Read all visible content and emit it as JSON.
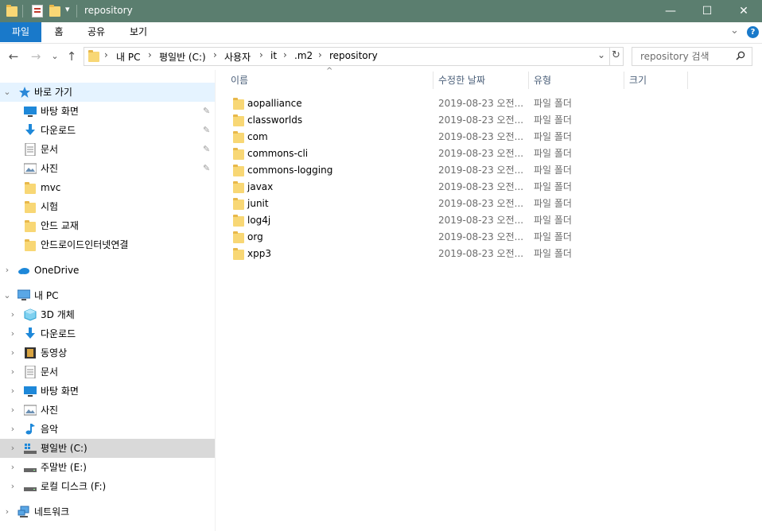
{
  "window": {
    "title": "repository",
    "qat_dropdown": "▾",
    "minimize": "—",
    "maximize": "☐",
    "close": "✕"
  },
  "ribbon": {
    "tabs": [
      "파일",
      "홈",
      "공유",
      "보기"
    ],
    "expand": "⌄",
    "help": "?"
  },
  "nav": {
    "back": "←",
    "forward": "→",
    "recent": "⌄",
    "up": "↑"
  },
  "address": {
    "crumbs": [
      "내 PC",
      "평일반 (C:)",
      "사용자",
      "it",
      ".m2",
      "repository"
    ],
    "separator": "›",
    "dropdown": "⌄",
    "refresh": "↻"
  },
  "search": {
    "placeholder": "repository 검색",
    "icon": "search-icon"
  },
  "navpane": {
    "quick_access": "바로 가기",
    "quick_items": [
      {
        "label": "바탕 화면",
        "icon": "desktop-icon",
        "pinned": true
      },
      {
        "label": "다운로드",
        "icon": "download-icon",
        "pinned": true
      },
      {
        "label": "문서",
        "icon": "document-icon",
        "pinned": true
      },
      {
        "label": "사진",
        "icon": "picture-icon",
        "pinned": true
      },
      {
        "label": "mvc",
        "icon": "folder-icon",
        "pinned": false
      },
      {
        "label": "시험",
        "icon": "folder-icon",
        "pinned": false
      },
      {
        "label": "안드 교재",
        "icon": "folder-icon",
        "pinned": false
      },
      {
        "label": "안드로이드인터넷연결",
        "icon": "folder-icon",
        "pinned": false
      }
    ],
    "onedrive": "OneDrive",
    "this_pc": "내 PC",
    "pc_items": [
      {
        "label": "3D 개체",
        "icon": "3d-objects-icon"
      },
      {
        "label": "다운로드",
        "icon": "download-icon"
      },
      {
        "label": "동영상",
        "icon": "video-icon"
      },
      {
        "label": "문서",
        "icon": "document-icon"
      },
      {
        "label": "바탕 화면",
        "icon": "desktop-icon"
      },
      {
        "label": "사진",
        "icon": "picture-icon"
      },
      {
        "label": "음악",
        "icon": "music-icon"
      },
      {
        "label": "평일반 (C:)",
        "icon": "drive-icon"
      },
      {
        "label": "주말반 (E:)",
        "icon": "drive-icon"
      },
      {
        "label": "로컬 디스크 (F:)",
        "icon": "drive-icon"
      }
    ],
    "network": "네트워크",
    "pin_glyph": "📌"
  },
  "content": {
    "columns": {
      "name": "이름",
      "date": "수정한 날짜",
      "type": "유형",
      "size": "크기"
    },
    "sort_indicator": "^",
    "files": [
      {
        "name": "aopalliance",
        "date": "2019-08-23 오전...",
        "type": "파일 폴더"
      },
      {
        "name": "classworlds",
        "date": "2019-08-23 오전...",
        "type": "파일 폴더"
      },
      {
        "name": "com",
        "date": "2019-08-23 오전...",
        "type": "파일 폴더"
      },
      {
        "name": "commons-cli",
        "date": "2019-08-23 오전...",
        "type": "파일 폴더"
      },
      {
        "name": "commons-logging",
        "date": "2019-08-23 오전...",
        "type": "파일 폴더"
      },
      {
        "name": "javax",
        "date": "2019-08-23 오전...",
        "type": "파일 폴더"
      },
      {
        "name": "junit",
        "date": "2019-08-23 오전...",
        "type": "파일 폴더"
      },
      {
        "name": "log4j",
        "date": "2019-08-23 오전...",
        "type": "파일 폴더"
      },
      {
        "name": "org",
        "date": "2019-08-23 오전...",
        "type": "파일 폴더"
      },
      {
        "name": "xpp3",
        "date": "2019-08-23 오전...",
        "type": "파일 폴더"
      }
    ]
  }
}
